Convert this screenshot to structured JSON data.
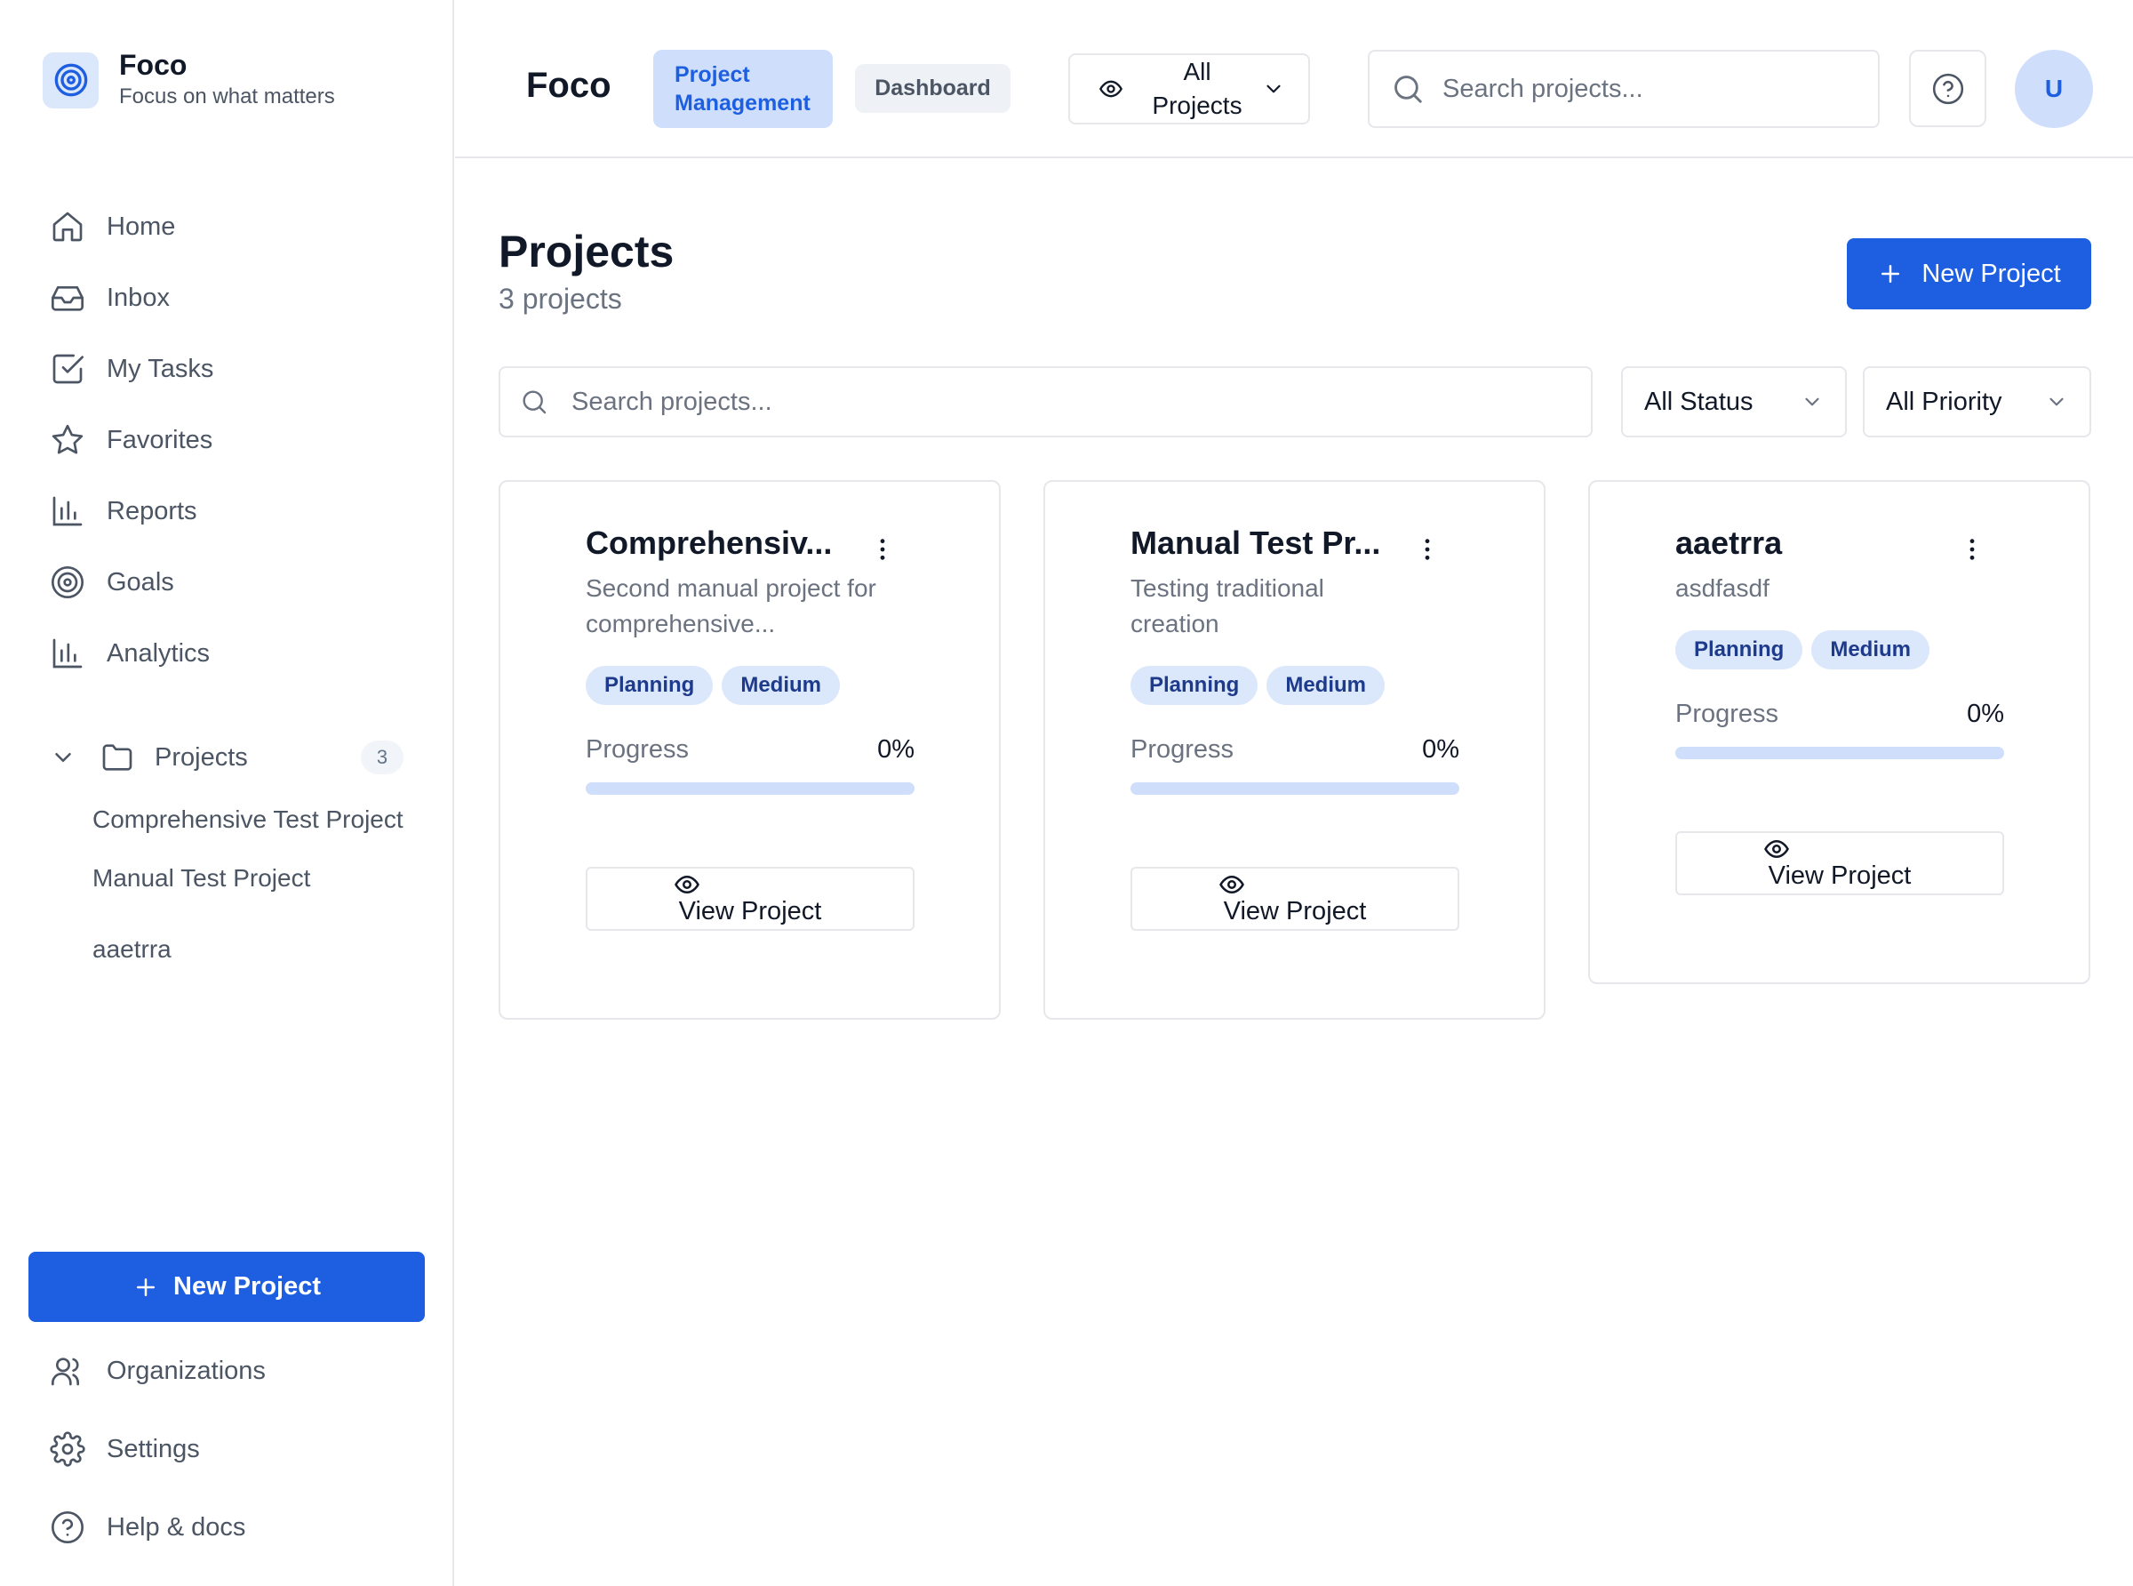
{
  "sidebar": {
    "brand_name": "Foco",
    "brand_tagline": "Focus on what matters",
    "nav": [
      {
        "label": "Home",
        "icon": "home-icon"
      },
      {
        "label": "Inbox",
        "icon": "inbox-icon"
      },
      {
        "label": "My Tasks",
        "icon": "check-square-icon"
      },
      {
        "label": "Favorites",
        "icon": "star-icon"
      },
      {
        "label": "Reports",
        "icon": "bar-chart-icon"
      },
      {
        "label": "Goals",
        "icon": "target-icon"
      },
      {
        "label": "Analytics",
        "icon": "bar-chart-icon"
      }
    ],
    "projects": {
      "label": "Projects",
      "count": "3",
      "items": [
        "Comprehensive Test Project",
        "Manual Test Project",
        "aaetrra"
      ]
    },
    "new_project_label": "New Project",
    "bottom_nav": [
      {
        "label": "Organizations",
        "icon": "users-icon"
      },
      {
        "label": "Settings",
        "icon": "gear-icon"
      },
      {
        "label": "Help & docs",
        "icon": "help-circle-icon"
      }
    ]
  },
  "topbar": {
    "title": "Foco",
    "tab_project_management": "Project Management",
    "tab_dashboard": "Dashboard",
    "view_selector": "All Projects",
    "search_placeholder": "Search projects...",
    "avatar_initial": "U"
  },
  "main": {
    "title": "Projects",
    "subtitle": "3 projects",
    "new_project_label": "New Project",
    "search_placeholder": "Search projects...",
    "status_filter": "All Status",
    "priority_filter": "All Priority",
    "cards": [
      {
        "title": "Comprehensiv...",
        "description": "Second manual project for comprehensive...",
        "status": "Planning",
        "priority": "Medium",
        "progress_label": "Progress",
        "progress_text": "0%",
        "progress": 0,
        "view_label": "View Project"
      },
      {
        "title": "Manual Test Pr...",
        "description": "Testing traditional creation",
        "status": "Planning",
        "priority": "Medium",
        "progress_label": "Progress",
        "progress_text": "0%",
        "progress": 0,
        "view_label": "View Project"
      },
      {
        "title": "aaetrra",
        "description": "asdfasdf",
        "status": "Planning",
        "priority": "Medium",
        "progress_label": "Progress",
        "progress_text": "0%",
        "progress": 0,
        "view_label": "View Project"
      }
    ]
  },
  "colors": {
    "accent": "#1d5fe0",
    "accent_light": "#cfdffb",
    "badge_bg": "#dbe7fb",
    "badge_text": "#1e3a8a",
    "border": "#e5e7eb",
    "muted_text": "#6b7280"
  }
}
